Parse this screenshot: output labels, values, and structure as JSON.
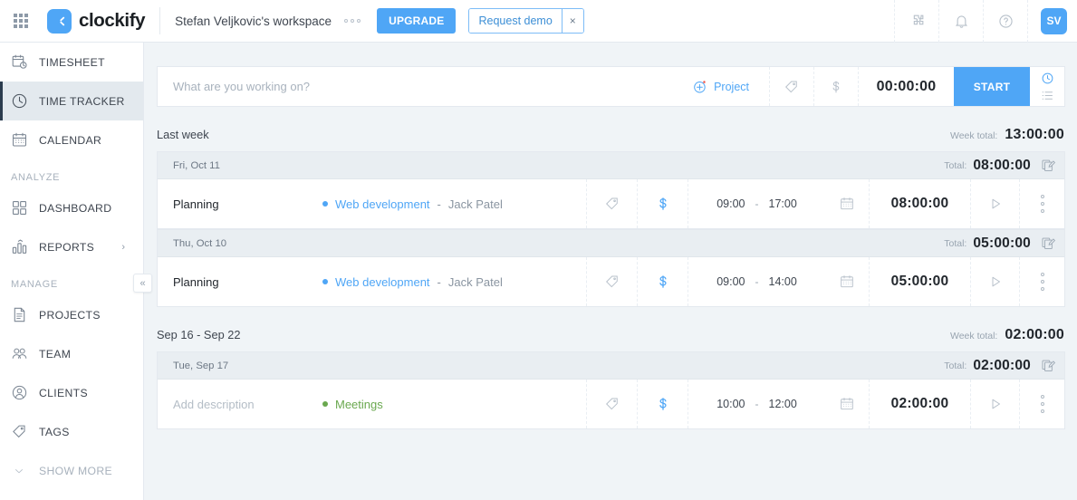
{
  "topbar": {
    "apps_icon": "grid-apps-icon",
    "logo_text": "clockify",
    "workspace": "Stefan Veljkovic's workspace",
    "workspace_menu_icon": "three-dots-icon",
    "upgrade_label": "UPGRADE",
    "demo_label": "Request demo",
    "demo_close": "×",
    "icons": [
      {
        "name": "puzzle-icon"
      },
      {
        "name": "bell-icon"
      },
      {
        "name": "help-icon"
      }
    ],
    "avatar_initials": "SV"
  },
  "sidebar": {
    "collapse_icon": "«",
    "groups": [
      {
        "title": "",
        "items": [
          {
            "label": "TIMESHEET",
            "icon": "timesheet-icon",
            "active": false
          },
          {
            "label": "TIME TRACKER",
            "icon": "clock-icon",
            "active": true
          },
          {
            "label": "CALENDAR",
            "icon": "calendar-icon",
            "active": false
          }
        ]
      },
      {
        "title": "ANALYZE",
        "items": [
          {
            "label": "DASHBOARD",
            "icon": "dashboard-icon",
            "active": false
          },
          {
            "label": "REPORTS",
            "icon": "reports-icon",
            "active": false,
            "chevron": "›"
          }
        ]
      },
      {
        "title": "MANAGE",
        "items": [
          {
            "label": "PROJECTS",
            "icon": "projects-icon",
            "active": false
          },
          {
            "label": "TEAM",
            "icon": "team-icon",
            "active": false
          },
          {
            "label": "CLIENTS",
            "icon": "clients-icon",
            "active": false
          },
          {
            "label": "TAGS",
            "icon": "tag-icon",
            "active": false
          },
          {
            "label": "SHOW MORE",
            "icon": "chevron-down-icon",
            "active": false,
            "muted": true
          }
        ]
      }
    ]
  },
  "timer": {
    "description_placeholder": "What are you working on?",
    "project_label": "Project",
    "project_add_icon": "plus-circle-icon",
    "tag_icon": "tag-icon",
    "billable_icon": "dollar-icon",
    "duration": "00:00:00",
    "start_label": "START",
    "mode_timer_icon": "clock-icon",
    "mode_manual_icon": "list-icon"
  },
  "weeks": [
    {
      "label": "Last week",
      "total_label": "Week total:",
      "total": "13:00:00",
      "days": [
        {
          "label": "Fri, Oct 11",
          "total_label": "Total:",
          "total": "08:00:00",
          "copy_icon": "duplicate-icon",
          "entries": [
            {
              "description": "Planning",
              "is_placeholder": false,
              "project": "Web development",
              "project_color": "#4fa6f6",
              "separator": "-",
              "client": "Jack Patel",
              "tag_icon": "tag-icon",
              "billable_icon": "dollar-icon",
              "billable_color": "#4fa6f6",
              "start": "09:00",
              "dash": "-",
              "end": "17:00",
              "calendar_icon": "calendar-icon",
              "duration": "08:00:00",
              "play_icon": "play-icon",
              "menu_icon": "more-vertical-icon"
            }
          ]
        },
        {
          "label": "Thu, Oct 10",
          "total_label": "Total:",
          "total": "05:00:00",
          "copy_icon": "duplicate-icon",
          "entries": [
            {
              "description": "Planning",
              "is_placeholder": false,
              "project": "Web development",
              "project_color": "#4fa6f6",
              "separator": "-",
              "client": "Jack Patel",
              "tag_icon": "tag-icon",
              "billable_icon": "dollar-icon",
              "billable_color": "#4fa6f6",
              "start": "09:00",
              "dash": "-",
              "end": "14:00",
              "calendar_icon": "calendar-icon",
              "duration": "05:00:00",
              "play_icon": "play-icon",
              "menu_icon": "more-vertical-icon"
            }
          ]
        }
      ]
    },
    {
      "label": "Sep 16 - Sep 22",
      "total_label": "Week total:",
      "total": "02:00:00",
      "days": [
        {
          "label": "Tue, Sep 17",
          "total_label": "Total:",
          "total": "02:00:00",
          "copy_icon": "duplicate-icon",
          "entries": [
            {
              "description": "Add description",
              "is_placeholder": true,
              "project": "Meetings",
              "project_color": "#6aa84f",
              "separator": "",
              "client": "",
              "tag_icon": "tag-icon",
              "billable_icon": "dollar-icon",
              "billable_color": "#4fa6f6",
              "start": "10:00",
              "dash": "-",
              "end": "12:00",
              "calendar_icon": "calendar-icon",
              "duration": "02:00:00",
              "play_icon": "play-icon",
              "menu_icon": "more-vertical-icon"
            }
          ]
        }
      ]
    }
  ],
  "colors": {
    "accent": "#4fa6f6",
    "page_bg": "#f0f4f7",
    "border": "#e4e9ef",
    "text": "#22272d",
    "muted": "#98a4b0"
  }
}
